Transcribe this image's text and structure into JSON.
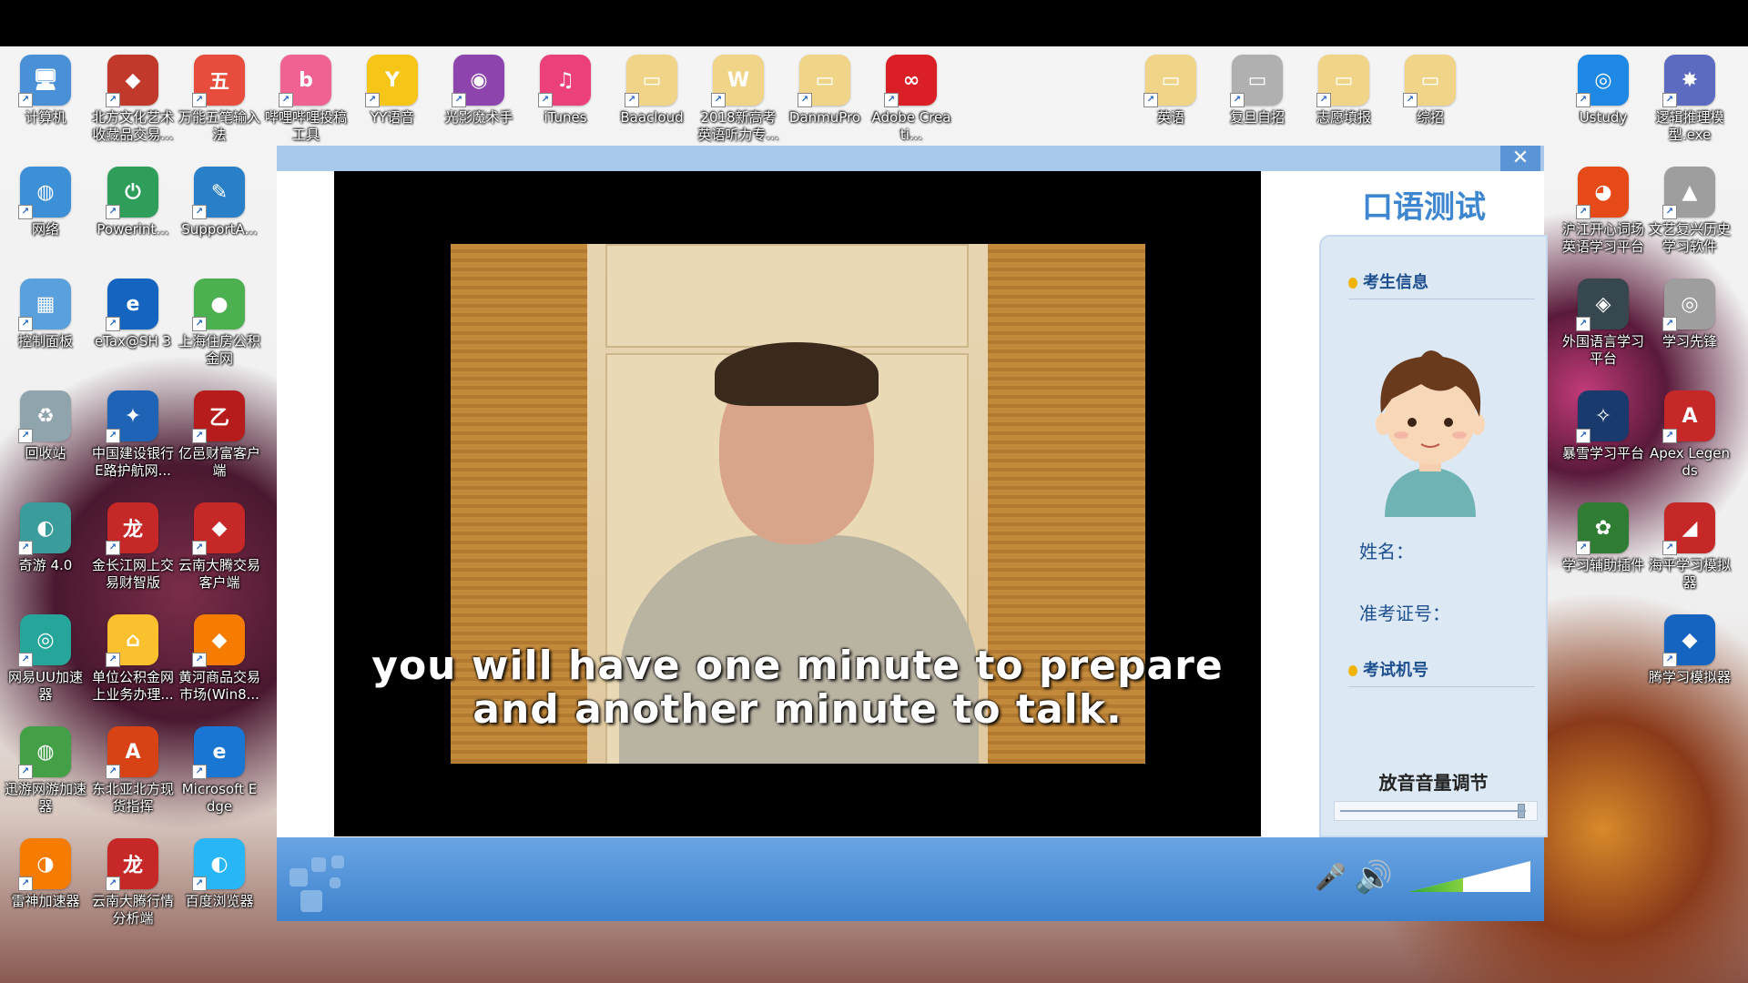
{
  "desktop": {
    "icons": [
      {
        "label": "计算机",
        "color": "#4a90d9",
        "glyph": "🖥"
      },
      {
        "label": "北方文化艺术收藏品交易...",
        "color": "#c0392b",
        "glyph": "◆"
      },
      {
        "label": "万能五笔输入法",
        "color": "#e74c3c",
        "glyph": "五"
      },
      {
        "label": "哔哩哔哩投稿工具",
        "color": "#f06292",
        "glyph": "b"
      },
      {
        "label": "YY语音",
        "color": "#f5c518",
        "glyph": "Y"
      },
      {
        "label": "光影魔术手",
        "color": "#8e44ad",
        "glyph": "◉"
      },
      {
        "label": "iTunes",
        "color": "#ec407a",
        "glyph": "♫"
      },
      {
        "label": "Baacloud",
        "color": "#f0d488",
        "glyph": "▭"
      },
      {
        "label": "2018新高考英语听力专...",
        "color": "#f0d488",
        "glyph": "W"
      },
      {
        "label": "DanmuPro",
        "color": "#f0d488",
        "glyph": "▭"
      },
      {
        "label": "Adobe Creati...",
        "color": "#da1f26",
        "glyph": "∞"
      },
      {
        "label": "英语",
        "color": "#f0d488",
        "glyph": "▭"
      },
      {
        "label": "复旦自招",
        "color": "#b0b0b0",
        "glyph": "▭"
      },
      {
        "label": "志愿填报",
        "color": "#f0d488",
        "glyph": "▭"
      },
      {
        "label": "综招",
        "color": "#f0d488",
        "glyph": "▭"
      },
      {
        "label": "Ustudy",
        "color": "#1e88e5",
        "glyph": "◎"
      },
      {
        "label": "逻辑推理模型.exe",
        "color": "#5c6bc0",
        "glyph": "✸"
      },
      {
        "label": "网络",
        "color": "#3d8fd6",
        "glyph": "◍"
      },
      {
        "label": "Powerint...",
        "color": "#2e9e5a",
        "glyph": "⏻"
      },
      {
        "label": "SupportA...",
        "color": "#2a7fc9",
        "glyph": "✎"
      },
      {
        "label": "控制面板",
        "color": "#5aa0dc",
        "glyph": "▦"
      },
      {
        "label": "eTax@SH 3",
        "color": "#1565c0",
        "glyph": "e"
      },
      {
        "label": "上海住房公积金网",
        "color": "#4caf50",
        "glyph": "●"
      },
      {
        "label": "回收站",
        "color": "#90a4ae",
        "glyph": "♻"
      },
      {
        "label": "中国建设银行E路护航网...",
        "color": "#1e63b5",
        "glyph": "✦"
      },
      {
        "label": "亿邑财富客户端",
        "color": "#b71c1c",
        "glyph": "乙"
      },
      {
        "label": "奇游 4.0",
        "color": "#3b9c9c",
        "glyph": "◐"
      },
      {
        "label": "金长江网上交易财智版",
        "color": "#c62828",
        "glyph": "龙"
      },
      {
        "label": "云南大腾交易客户端",
        "color": "#c62828",
        "glyph": "◆"
      },
      {
        "label": "网易UU加速器",
        "color": "#26a69a",
        "glyph": "◎"
      },
      {
        "label": "单位公积金网上业务办理...",
        "color": "#fbc02d",
        "glyph": "⌂"
      },
      {
        "label": "黄河商品交易市场(Win8...",
        "color": "#f57c00",
        "glyph": "◆"
      },
      {
        "label": "迅游网游加速器",
        "color": "#43a047",
        "glyph": "◍"
      },
      {
        "label": "东北亚北方现货指挥",
        "color": "#d84315",
        "glyph": "A"
      },
      {
        "label": "Microsoft Edge",
        "color": "#1976d2",
        "glyph": "e"
      },
      {
        "label": "雷神加速器",
        "color": "#f57c00",
        "glyph": "◑"
      },
      {
        "label": "云南大腾行情分析端",
        "color": "#c62828",
        "glyph": "龙"
      },
      {
        "label": "百度浏览器",
        "color": "#29b6f6",
        "glyph": "◐"
      },
      {
        "label": "沪江开心词场英语学习平台",
        "color": "#e64a19",
        "glyph": "◕"
      },
      {
        "label": "文艺复兴历史学习软件",
        "color": "#9e9e9e",
        "glyph": "▲"
      },
      {
        "label": "外国语言学习平台",
        "color": "#37474f",
        "glyph": "◈"
      },
      {
        "label": "学习先锋",
        "color": "#9e9e9e",
        "glyph": "◎"
      },
      {
        "label": "暴雪学习平台",
        "color": "#1a3a6e",
        "glyph": "✧"
      },
      {
        "label": "Apex Legends",
        "color": "#c62828",
        "glyph": "A"
      },
      {
        "label": "学习辅助插件",
        "color": "#2e7d32",
        "glyph": "✿"
      },
      {
        "label": "海平学习模拟器",
        "color": "#c62828",
        "glyph": "◢"
      },
      {
        "label": "腾学习模拟器",
        "color": "#1565c0",
        "glyph": "◆"
      }
    ]
  },
  "dialog": {
    "close_label": "✕",
    "subtitle_line1": "you will have one minute to prepare",
    "subtitle_line2": "and another minute to talk.",
    "side_title": "口语测试",
    "section_examinee": "考生信息",
    "name_label": "姓名：",
    "ticket_label": "准考证号：",
    "section_machine": "考试机号",
    "playback_volume_label": "放音音量调节",
    "playback_volume_level": 0.95,
    "speaker_icon": "🔊",
    "mic_icon": "🎤",
    "mic_level": 0.45
  }
}
